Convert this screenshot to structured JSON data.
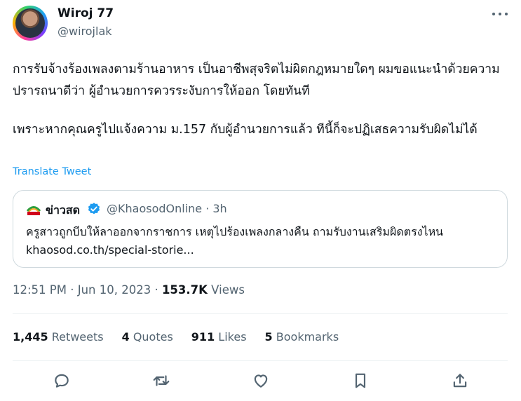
{
  "author": {
    "display_name": "Wiroj 77",
    "handle": "@wirojlak"
  },
  "tweet": {
    "paragraphs": [
      "การรับจ้างร้องเพลงตามร้านอาหาร เป็นอาชีพสุจริตไม่ผิดกฎหมายใดๆ ผมขอแนะนำด้วยความปรารถนาดีว่า ผู้อำนวยการควรระงับการให้ออก โดยทันที",
      "เพราะหากคุณครูไปแจ้งความ ม.157 กับผู้อำนวยการแล้ว ทีนี้ก็จะปฏิเสธความรับผิดไม่ได้"
    ],
    "translate_label": "Translate Tweet"
  },
  "quote": {
    "name": "ข่าวสด",
    "handle_time": "@KhaosodOnline · 3h",
    "text": "ครูสาวถูกบีบให้ลาออกจากราชการ เหตุไปร้องเพลงกลางคืน ถามรับงานเสริมผิดตรงไหน",
    "link": "khaosod.co.th/special-storie..."
  },
  "meta": {
    "time_date": "12:51 PM · Jun 10, 2023 · ",
    "views_count": "153.7K",
    "views_label": " Views"
  },
  "stats": [
    {
      "count": "1,445",
      "label": " Retweets"
    },
    {
      "count": "4",
      "label": " Quotes"
    },
    {
      "count": "911",
      "label": " Likes"
    },
    {
      "count": "5",
      "label": " Bookmarks"
    }
  ],
  "colors": {
    "accent": "#1d9bf0",
    "secondary_text": "#536471",
    "border": "#cfd9de"
  },
  "icons": [
    "more-icon",
    "verified-badge-icon",
    "reply-icon",
    "retweet-icon",
    "like-icon",
    "bookmark-icon",
    "share-icon"
  ]
}
